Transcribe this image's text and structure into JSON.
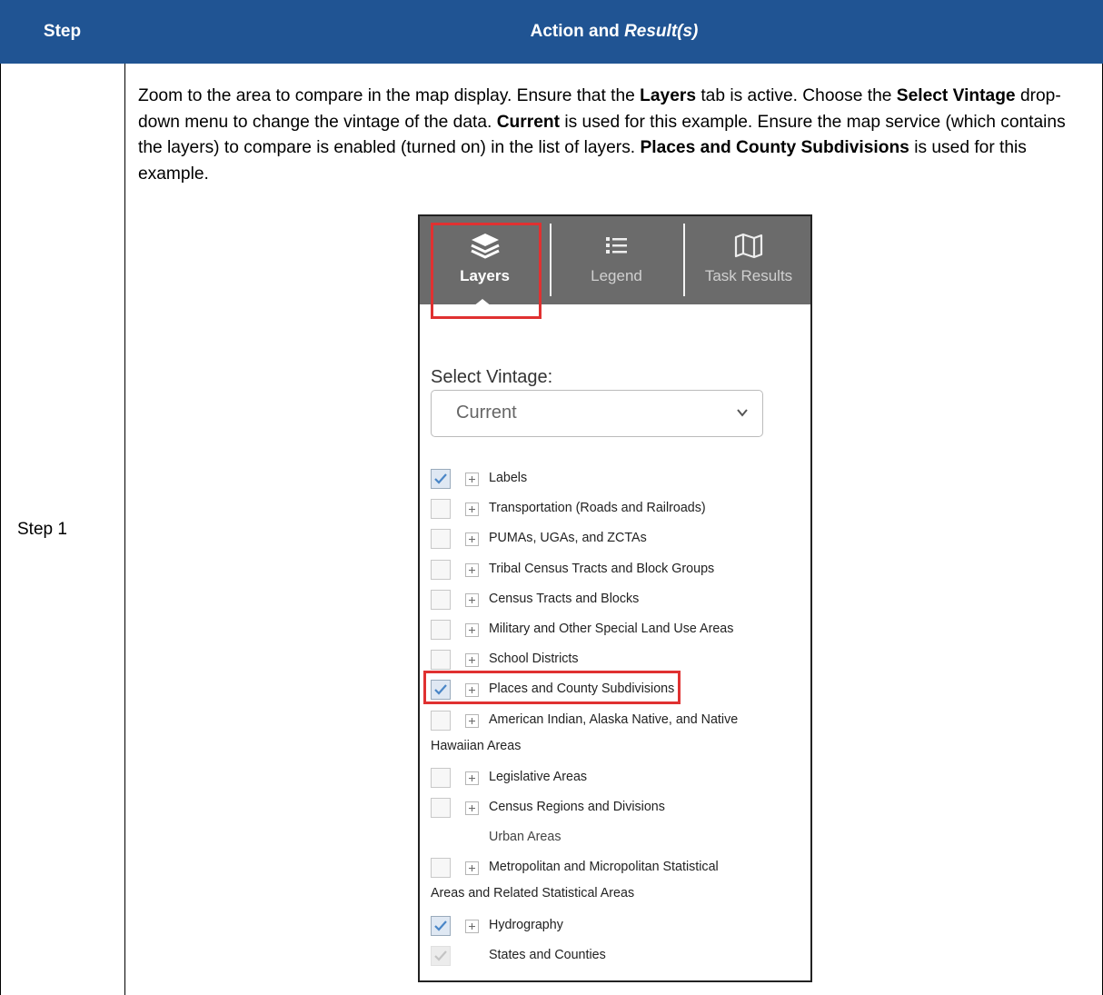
{
  "table": {
    "header": {
      "step": "Step",
      "action_prefix": "Action and ",
      "action_italic": "Result(s)"
    },
    "rows": [
      {
        "step": "Step 1",
        "paragraph": [
          {
            "t": "Zoom to the area to compare in the map display. Ensure that the ",
            "b": false
          },
          {
            "t": "Layers",
            "b": true
          },
          {
            "t": " tab is active. Choose the ",
            "b": false
          },
          {
            "t": "Select Vintage",
            "b": true
          },
          {
            "t": " drop-down menu to change the vintage of the data. ",
            "b": false
          },
          {
            "t": "Current",
            "b": true
          },
          {
            "t": " is used for this example. Ensure the map service (which contains the layers) to compare is enabled (turned on) in the list of layers. ",
            "b": false
          },
          {
            "t": "Places and County Subdivisions",
            "b": true
          },
          {
            "t": " is used for this example.",
            "b": false
          }
        ]
      }
    ]
  },
  "screenshot": {
    "tabs": [
      {
        "label": "Layers",
        "icon": "layers-icon",
        "active": true
      },
      {
        "label": "Legend",
        "icon": "list-icon",
        "active": false
      },
      {
        "label": "Task Results",
        "icon": "map-icon",
        "active": false
      }
    ],
    "select_vintage": {
      "label": "Select Vintage:",
      "value": "Current"
    },
    "layers": [
      {
        "name": "Labels",
        "checked": true,
        "expandable": true
      },
      {
        "name": "Transportation (Roads and Railroads)",
        "checked": false,
        "expandable": true
      },
      {
        "name": "PUMAs, UGAs, and ZCTAs",
        "checked": false,
        "expandable": true
      },
      {
        "name": "Tribal Census Tracts and Block Groups",
        "checked": false,
        "expandable": true
      },
      {
        "name": "Census Tracts and Blocks",
        "checked": false,
        "expandable": true
      },
      {
        "name": "Military and Other Special Land Use Areas",
        "checked": false,
        "expandable": true
      },
      {
        "name": "School Districts",
        "checked": false,
        "expandable": true
      },
      {
        "name": "Places and County Subdivisions",
        "checked": true,
        "expandable": true,
        "highlighted": true
      },
      {
        "name": "American Indian, Alaska Native, and Native",
        "name_cont": "Hawaiian Areas",
        "checked": false,
        "expandable": true
      },
      {
        "name": "Legislative Areas",
        "checked": false,
        "expandable": true
      },
      {
        "name": "Census Regions and Divisions",
        "checked": false,
        "expandable": true
      },
      {
        "name": "Urban Areas",
        "checked": null,
        "expandable": false
      },
      {
        "name": "Metropolitan and Micropolitan Statistical",
        "name_cont": "Areas and Related Statistical Areas",
        "checked": false,
        "expandable": true
      },
      {
        "name": "Hydrography",
        "checked": true,
        "expandable": true
      },
      {
        "name": "States and Counties",
        "checked": true,
        "disabled": true,
        "expandable": false
      }
    ]
  }
}
